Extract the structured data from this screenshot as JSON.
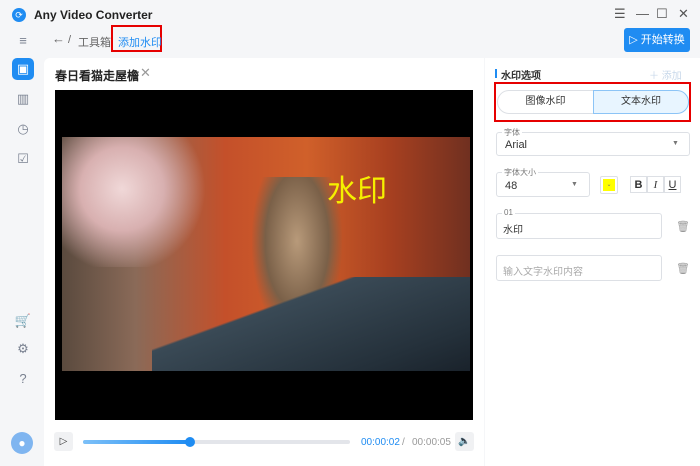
{
  "app": {
    "title": "Any Video Converter"
  },
  "breadcrumb": {
    "back": "←",
    "sep": "/",
    "parent": "工具箱",
    "current": "添加水印"
  },
  "toolbar": {
    "start_label": "开始转换"
  },
  "file": {
    "name": "春日看猫走屋檐"
  },
  "video": {
    "watermark_text": "水印",
    "watermark_color": "#f5f000"
  },
  "player": {
    "current_time": "00:00:02",
    "total_time": "00:00:05",
    "separator": "/",
    "progress": 0.4
  },
  "options": {
    "section_title": "水印选项",
    "add_label": "添加",
    "tabs": [
      {
        "label": "图像水印",
        "active": false
      },
      {
        "label": "文本水印",
        "active": true
      }
    ],
    "font_label": "字体",
    "font_value": "Arial",
    "size_label": "字体大小",
    "size_value": "48",
    "color": "#ffff00",
    "format": {
      "bold": "B",
      "italic": "I",
      "underline": "U"
    },
    "entries": [
      {
        "label": "01",
        "value": "水印"
      }
    ],
    "new_placeholder": "输入文字水印内容"
  },
  "colors": {
    "accent": "#1f8cf2",
    "highlight": "#e60000"
  }
}
